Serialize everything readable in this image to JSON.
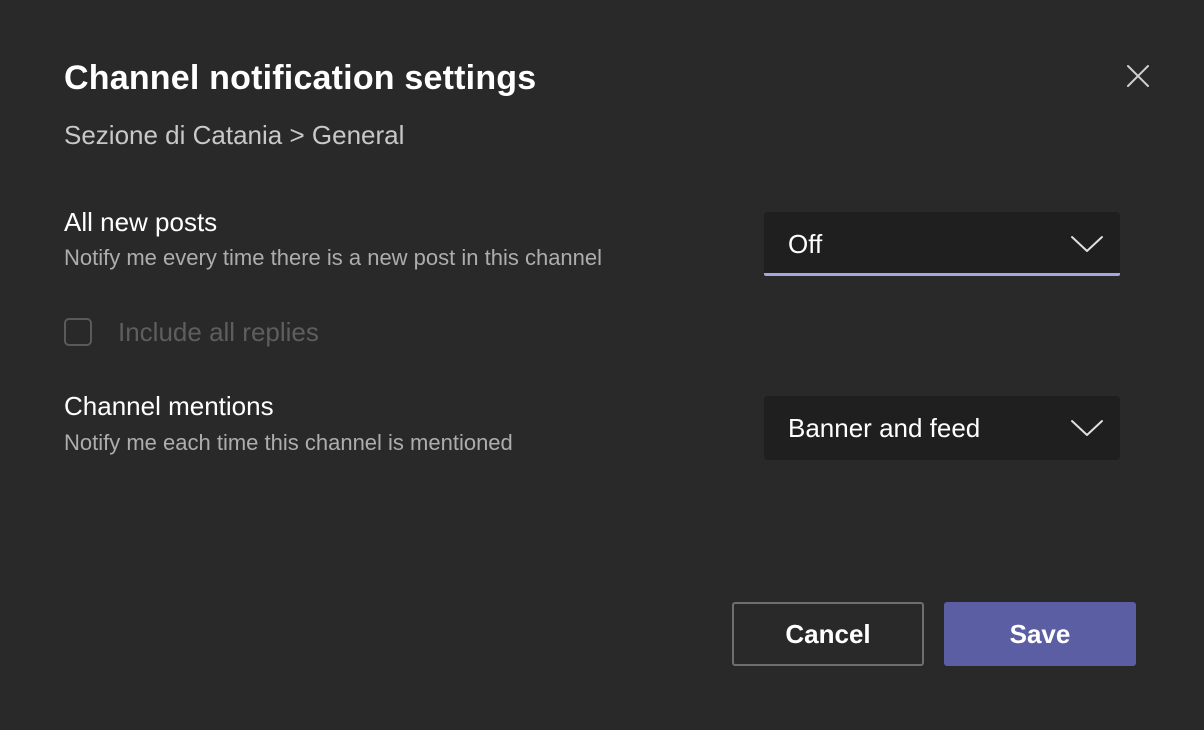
{
  "dialog": {
    "title": "Channel notification settings",
    "close_icon": "close-icon",
    "breadcrumb": {
      "team": "Sezione di Catania",
      "separator": " > ",
      "channel": "General"
    }
  },
  "settings": {
    "all_posts": {
      "label": "All new posts",
      "description": "Notify me every time there is a new post in this channel",
      "selected": "Off",
      "chevron_icon": "chevron-down-icon"
    },
    "include_replies": {
      "label": "Include all replies",
      "checked": false,
      "disabled": true
    },
    "mentions": {
      "label": "Channel mentions",
      "description": "Notify me each time this channel is mentioned",
      "selected": "Banner and feed",
      "chevron_icon": "chevron-down-icon"
    }
  },
  "actions": {
    "cancel_label": "Cancel",
    "save_label": "Save"
  },
  "colors": {
    "background": "#292929",
    "accent": "#5c5ea4",
    "focus_underline": "#a6a7dc",
    "text_primary": "#ffffff",
    "text_secondary": "#adadad",
    "text_disabled": "#5e5e5e"
  }
}
